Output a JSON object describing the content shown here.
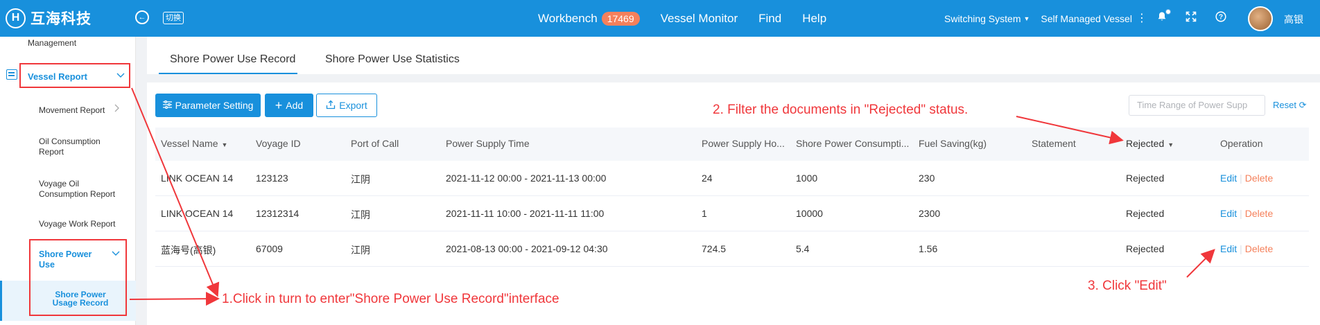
{
  "header": {
    "logo_mark": "H",
    "logo_text": "互海科技",
    "switch_label": "切换",
    "nav": {
      "workbench": "Workbench",
      "workbench_badge": "17469",
      "vessel_monitor": "Vessel Monitor",
      "find": "Find",
      "help": "Help"
    },
    "switching_system": "Switching System",
    "self_managed_vessel": "Self Managed Vessel",
    "user_name": "高银",
    "icons": [
      "bell-icon",
      "fullscreen-icon",
      "help-icon"
    ]
  },
  "sidebar": {
    "management": "Management",
    "vessel_report": "Vessel Report",
    "movement_report": "Movement Report",
    "oil_consumption_report": "Oil Consumption Report",
    "voyage_oil_consumption_report": "Voyage Oil Consumption Report",
    "voyage_work_report": "Voyage Work Report",
    "shore_power_use": "Shore Power Use",
    "shore_power_usage_record": "Shore Power Usage Record"
  },
  "tabs": [
    "Shore Power Use Record",
    "Shore Power Use Statistics"
  ],
  "toolbar": {
    "parameter_setting": "Parameter Setting",
    "add": "Add",
    "export": "Export",
    "date_placeholder": "Time Range of Power Supp",
    "reset": "Reset"
  },
  "table": {
    "headers": [
      "Vessel Name",
      "Voyage ID",
      "Port of Call",
      "Power Supply Time",
      "Power Supply Ho...",
      "Shore Power Consumpti...",
      "Fuel Saving(kg)",
      "Statement",
      "Rejected",
      "Operation"
    ],
    "rows": [
      {
        "vessel": "LINK OCEAN 14",
        "voyage": "123123",
        "port": "江阴",
        "time": "2021-11-12 00:00 - 2021-11-13 00:00",
        "hours": "24",
        "consumption": "1000",
        "fuel": "230",
        "statement": "",
        "status": "Rejected",
        "edit": "Edit",
        "delete": "Delete"
      },
      {
        "vessel": "LINK OCEAN 14",
        "voyage": "12312314",
        "port": "江阴",
        "time": "2021-11-11 10:00 - 2021-11-11 11:00",
        "hours": "1",
        "consumption": "10000",
        "fuel": "2300",
        "statement": "",
        "status": "Rejected",
        "edit": "Edit",
        "delete": "Delete"
      },
      {
        "vessel": "蓝海号(高银)",
        "voyage": "67009",
        "port": "江阴",
        "time": "2021-08-13 00:00 - 2021-09-12 04:30",
        "hours": "724.5",
        "consumption": "5.4",
        "fuel": "1.56",
        "statement": "",
        "status": "Rejected",
        "edit": "Edit",
        "delete": "Delete"
      }
    ]
  },
  "annotations": {
    "step1": "1.Click in turn to enter\"Shore Power Use Record\"interface",
    "step2": "2. Filter the documents in \"Rejected\" status.",
    "step3": "3. Click \"Edit\""
  },
  "colors": {
    "primary": "#1890dc",
    "danger": "#f5805b",
    "annotation": "#f0373b"
  }
}
